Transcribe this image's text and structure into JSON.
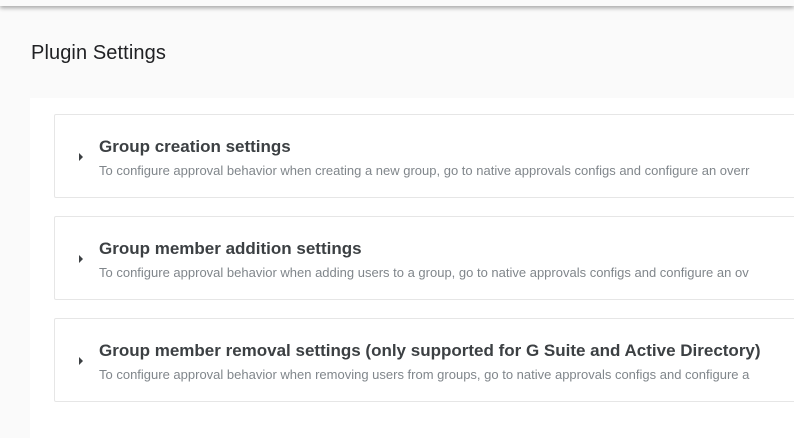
{
  "page": {
    "title": "Plugin Settings"
  },
  "sections": [
    {
      "title": "Group creation settings",
      "description": "To configure approval behavior when creating a new group, go to native approvals configs and configure an overr"
    },
    {
      "title": "Group member addition settings",
      "description": "To configure approval behavior when adding users to a group, go to native approvals configs and configure an ov"
    },
    {
      "title": "Group member removal settings (only supported for G Suite and Active Directory)",
      "description": "To configure approval behavior when removing users from groups, go to native approvals configs and configure a"
    }
  ],
  "icons": {
    "expand": "chevron-right-icon"
  },
  "colors": {
    "title": "#3c4043",
    "description": "#80868b",
    "background": "#fafafa"
  }
}
